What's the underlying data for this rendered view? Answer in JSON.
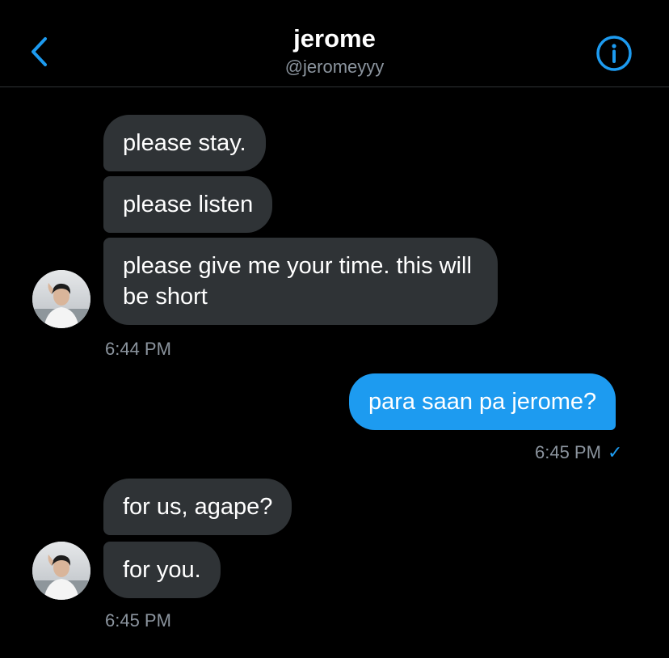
{
  "header": {
    "title": "jerome",
    "handle": "@jeromeyyy",
    "back_icon": "chevron-left-icon",
    "info_icon": "info-icon"
  },
  "colors": {
    "background": "#000000",
    "incoming_bubble": "#2f3336",
    "outgoing_bubble": "#1d9bf0",
    "accent": "#1d9bf0",
    "meta_text": "#8b949e"
  },
  "messages": [
    {
      "from": "them",
      "text": "please stay."
    },
    {
      "from": "them",
      "text": "please listen"
    },
    {
      "from": "them",
      "text": "please give me your time. this will be short"
    },
    {
      "from": "them_time",
      "text": "6:44 PM"
    },
    {
      "from": "me",
      "text": "para saan pa jerome?"
    },
    {
      "from": "me_time",
      "text": "6:45 PM",
      "status": "✓"
    },
    {
      "from": "them",
      "text": "for us, agape?"
    },
    {
      "from": "them",
      "text": "for you."
    },
    {
      "from": "them_time",
      "text": "6:45 PM"
    }
  ]
}
